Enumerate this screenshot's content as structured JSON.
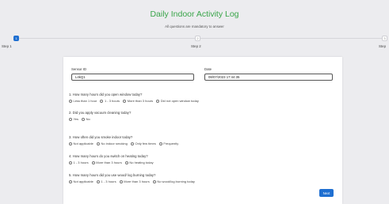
{
  "header": {
    "title": "Daily Indoor Activity Log",
    "subtitle": "All questions are mandatory to answer"
  },
  "stepper": {
    "steps": [
      {
        "number": "1",
        "label": "Step 1",
        "active": true
      },
      {
        "number": "2",
        "label": "Step 2",
        "active": false
      },
      {
        "number": "3",
        "label": "Step",
        "active": false
      }
    ]
  },
  "form": {
    "sensor_label": "Sensor ID",
    "sensor_value": "L4kQ1",
    "date_label": "Date",
    "date_value": "08/07/2023 17:44:35",
    "questions": [
      {
        "text": "1. How many hours did you open window today?",
        "options": [
          "Less than 1 hour",
          "1 - 3 hours",
          "More than 3 hours",
          "Did not open window today"
        ]
      },
      {
        "text": "2. Did you apply vacuum cleaning today?",
        "options": [
          "Yes",
          "No"
        ]
      },
      {
        "text": "3. How often did you smoke indoor today?",
        "options": [
          "Not applicable",
          "No indoor smoking",
          "Only few times",
          "Frequently"
        ]
      },
      {
        "text": "4. How many hours do you switch on heating today?",
        "options": [
          "1 - 3 hours",
          "More than 3 hours",
          "No heating today"
        ]
      },
      {
        "text": "5. How many hours did you use wood/ log burning today?",
        "options": [
          "Not applicable",
          "1 - 3 hours",
          "More than 3 hours",
          "No wood/log burning today"
        ]
      }
    ],
    "next_label": "Next"
  }
}
